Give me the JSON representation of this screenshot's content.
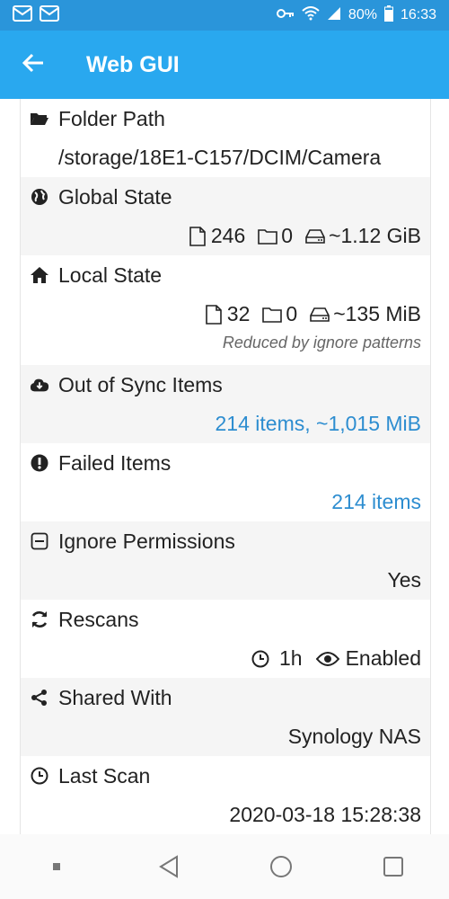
{
  "status": {
    "battery": "80%",
    "time": "16:33"
  },
  "appbar": {
    "title": "Web GUI"
  },
  "rows": {
    "folder_path": {
      "label": "Folder Path",
      "value": "/storage/18E1-C157/DCIM/Camera"
    },
    "global_state": {
      "label": "Global State",
      "files": "246",
      "folders": "0",
      "size": "~1.12 GiB"
    },
    "local_state": {
      "label": "Local State",
      "files": "32",
      "folders": "0",
      "size": "~135 MiB",
      "note": "Reduced by ignore patterns"
    },
    "out_of_sync": {
      "label": "Out of Sync Items",
      "value": "214 items, ~1,015 MiB"
    },
    "failed": {
      "label": "Failed Items",
      "value": "214 items"
    },
    "ignore_permissions": {
      "label": "Ignore Permissions",
      "value": "Yes"
    },
    "rescans": {
      "label": "Rescans",
      "interval": "1h",
      "watcher": "Enabled"
    },
    "shared_with": {
      "label": "Shared With",
      "value": "Synology NAS"
    },
    "last_scan": {
      "label": "Last Scan",
      "value": "2020-03-18 15:28:38"
    }
  },
  "colors": {
    "statusbar": "#2a95da",
    "appbar": "#29a8ef",
    "link": "#2d8dd0"
  }
}
